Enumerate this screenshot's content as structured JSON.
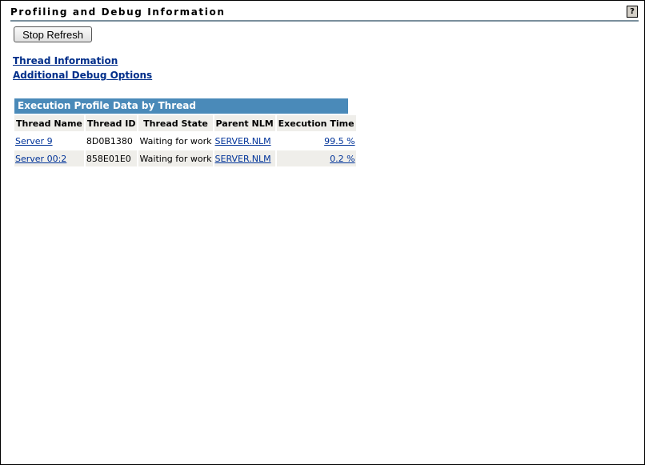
{
  "page": {
    "title": "Profiling and Debug Information",
    "help_icon": "help-icon"
  },
  "toolbar": {
    "stop_refresh": "Stop Refresh"
  },
  "links": {
    "thread_information": "Thread Information",
    "additional_debug": "Additional Debug Options"
  },
  "table": {
    "title": "Execution Profile Data by Thread",
    "columns": [
      "Thread Name",
      "Thread ID",
      "Thread State",
      "Parent NLM",
      "Execution Time"
    ],
    "rows": [
      {
        "name": "Server 9",
        "id": "8D0B1380",
        "state": "Waiting for work",
        "nlm": "SERVER.NLM",
        "time": "99.5 %"
      },
      {
        "name": "Server 00:2",
        "id": "858E01E0",
        "state": "Waiting for work",
        "nlm": "SERVER.NLM",
        "time": "0.2 %"
      }
    ]
  },
  "colors": {
    "header_bar": "#4a8ab9",
    "link": "#003399",
    "alt_row": "#efeeea"
  }
}
